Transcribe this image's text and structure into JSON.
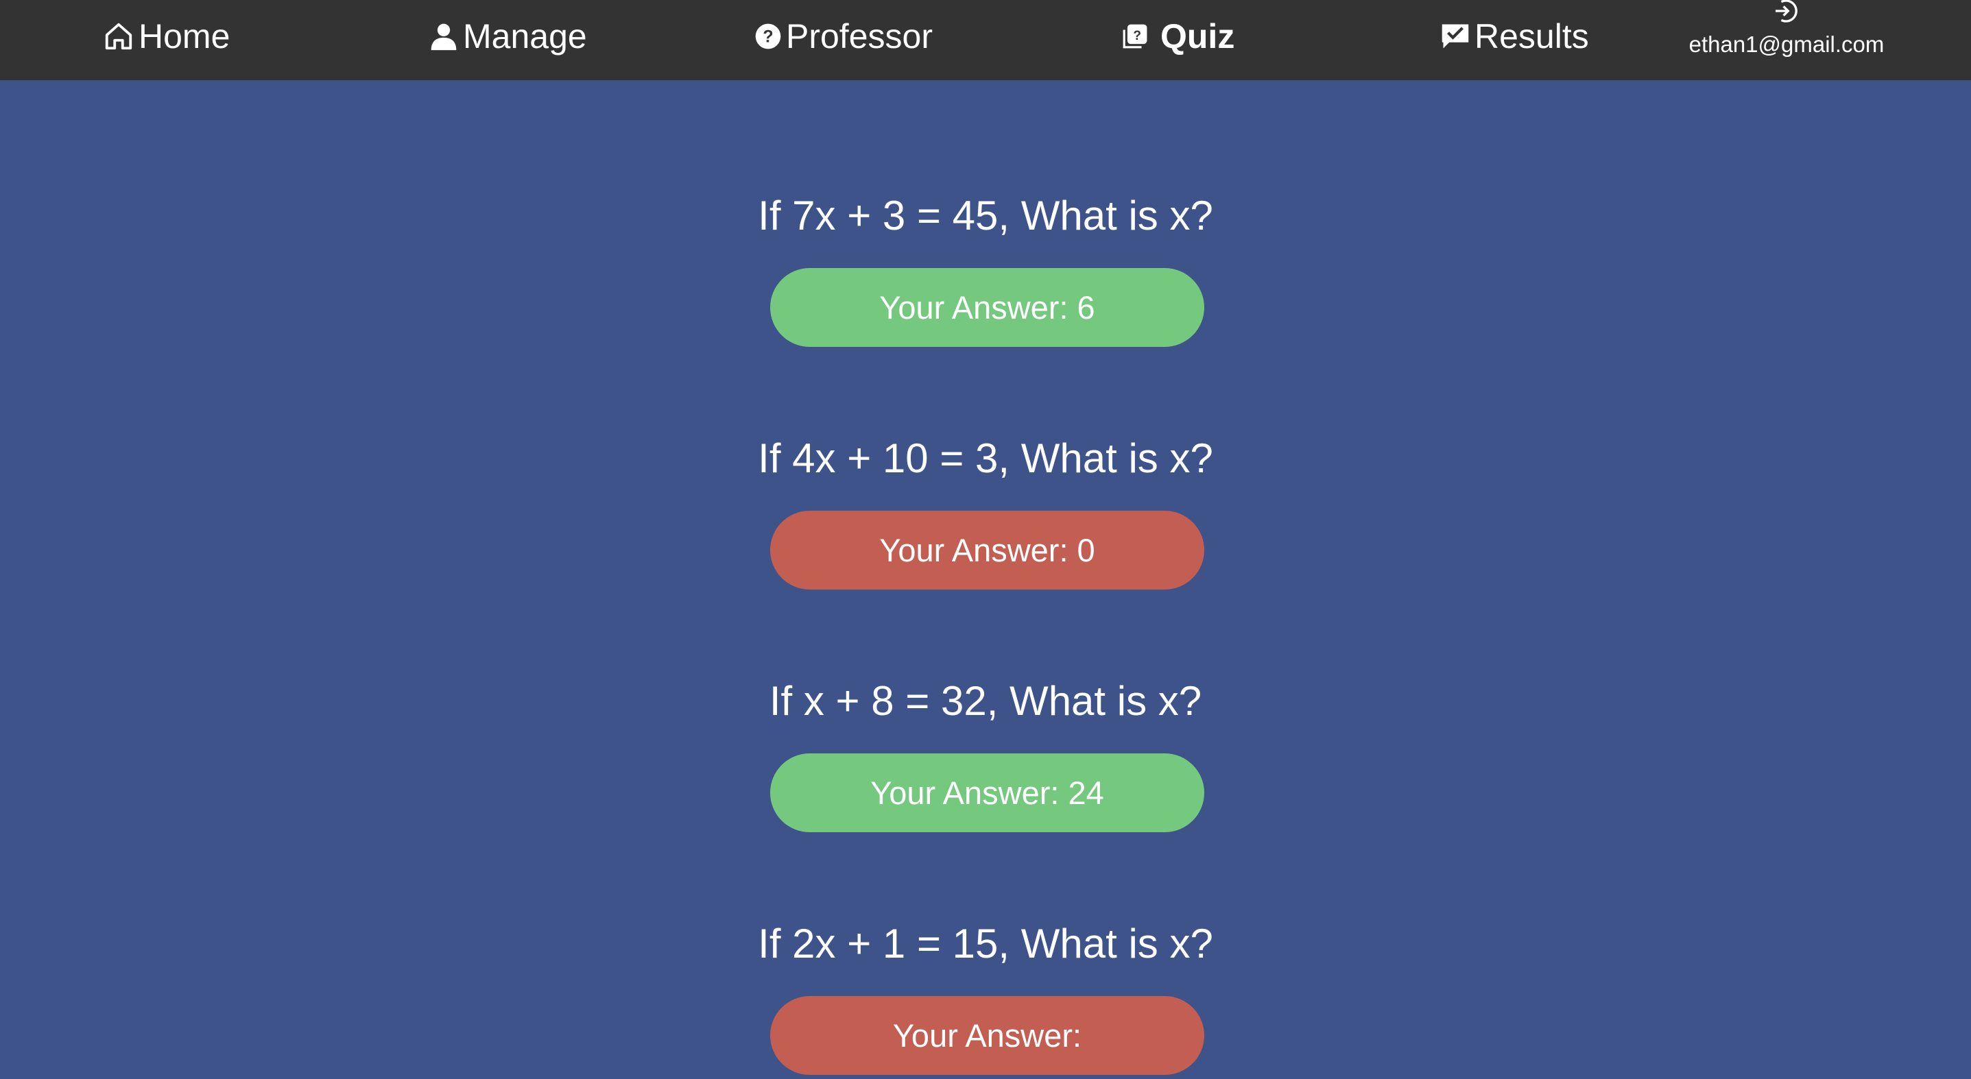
{
  "nav": {
    "items": [
      {
        "label": "Home",
        "icon": "home-icon"
      },
      {
        "label": "Manage",
        "icon": "person-icon"
      },
      {
        "label": "Professor",
        "icon": "question-circle-icon"
      },
      {
        "label": "Quiz",
        "icon": "quiz-icon",
        "active": true
      },
      {
        "label": "Results",
        "icon": "chat-check-icon"
      }
    ],
    "user_email": "ethan1@gmail.com",
    "logout_icon": "logout-icon"
  },
  "colors": {
    "navbar_bg": "#333333",
    "page_bg": "#3d5389",
    "correct": "#75c97f",
    "incorrect": "#c25f52"
  },
  "questions": [
    {
      "question": "If 7x + 3 = 45, What is x?",
      "answer_label": "Your Answer: 6",
      "status": "correct"
    },
    {
      "question": "If 4x + 10 = 3, What is x?",
      "answer_label": "Your Answer: 0",
      "status": "incorrect"
    },
    {
      "question": "If x + 8 = 32, What is x?",
      "answer_label": "Your Answer: 24",
      "status": "correct"
    },
    {
      "question": "If 2x + 1 = 15, What is x?",
      "answer_label": "Your Answer:",
      "status": "incorrect"
    }
  ]
}
